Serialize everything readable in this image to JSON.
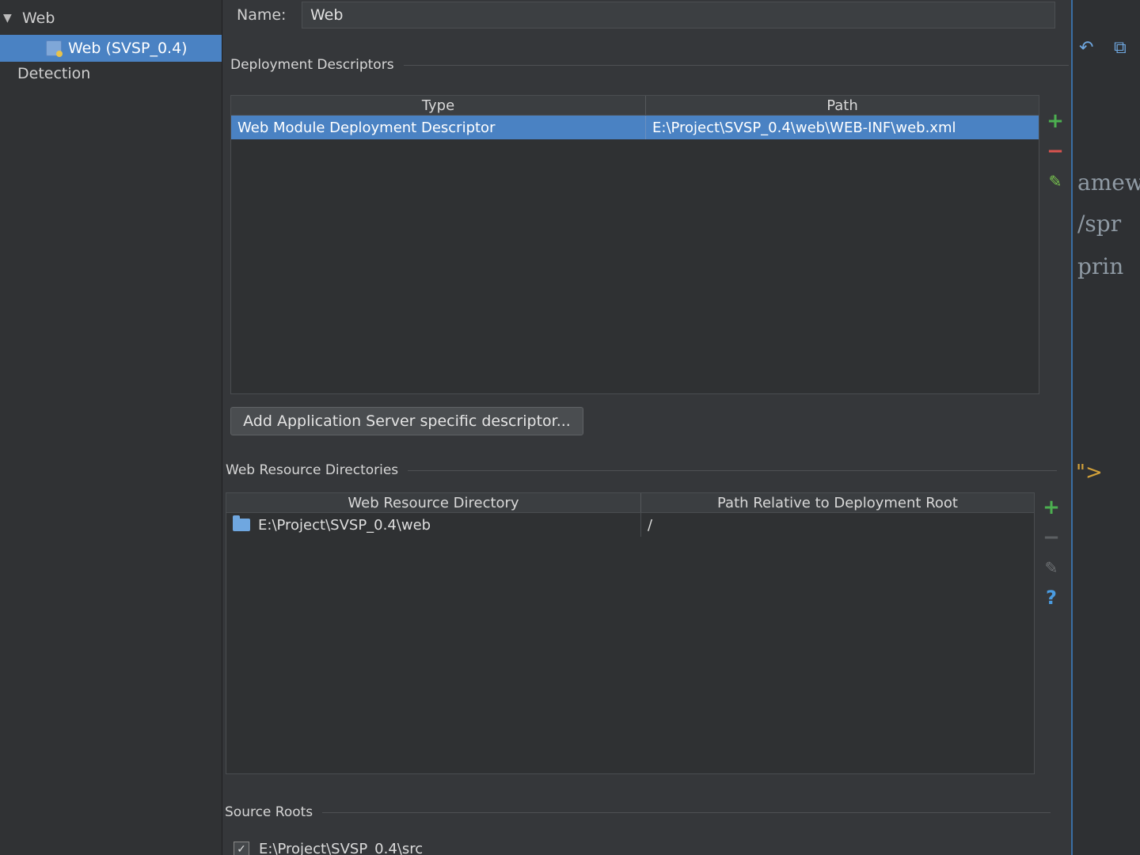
{
  "tree": {
    "root": "Web",
    "module": "Web (SVSP_0.4)",
    "detection": "Detection"
  },
  "name": {
    "label": "Name:",
    "value": "Web"
  },
  "deployment": {
    "title": "Deployment Descriptors",
    "columns": [
      "Type",
      "Path"
    ],
    "rows": [
      {
        "type": "Web Module Deployment Descriptor",
        "path": "E:\\Project\\SVSP_0.4\\web\\WEB-INF\\web.xml"
      }
    ],
    "add_button": "Add Application Server specific descriptor..."
  },
  "resources": {
    "title": "Web Resource Directories",
    "columns": [
      "Web Resource Directory",
      "Path Relative to Deployment Root"
    ],
    "rows": [
      {
        "dir": "E:\\Project\\SVSP_0.4\\web",
        "rel": "/"
      }
    ]
  },
  "sources": {
    "title": "Source Roots",
    "items": [
      {
        "path": "E:\\Project\\SVSP_0.4\\src",
        "checked": true
      }
    ]
  },
  "editor": {
    "lines": [
      "amew",
      "/spr",
      "prin"
    ],
    "arrow": "\">"
  },
  "icons": {
    "plus": "+",
    "minus": "−",
    "pencil": "✎",
    "help": "?",
    "undo": "↶",
    "copy": "⧉",
    "tree_expand": "▼"
  }
}
